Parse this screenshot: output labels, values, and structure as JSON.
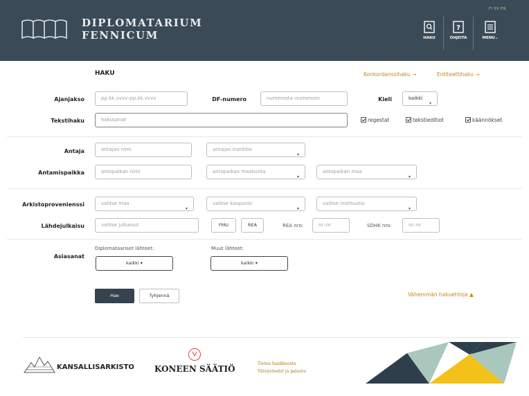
{
  "header": {
    "brand_line1": "DIPLOMATARIUM",
    "brand_line2": "FENNICUM",
    "languages": "FI SV EN",
    "buttons": {
      "search": "HAKU",
      "help": "OHJEITA",
      "menu": "MENU"
    }
  },
  "form": {
    "title": "HAKU",
    "links": {
      "concordance": "Konkordanssihaku →",
      "entity": "Entiteettihaku →"
    },
    "period": {
      "label": "Ajanjakso",
      "placeholder": "pp.kk.vvvv–pp.kk.vvvv"
    },
    "df_number": {
      "label": "DF-numero",
      "placeholder": "numerosta–numeroon"
    },
    "language": {
      "label": "Kieli",
      "value": "kaikki"
    },
    "text_search": {
      "label": "Tekstihaku",
      "placeholder": "hakusanat"
    },
    "checkboxes": [
      "regestat",
      "tekstieditiot",
      "käännökset"
    ],
    "issuer": {
      "label": "Antaja",
      "name_placeholder": "antajan nimi",
      "role_placeholder": "antajan instititio"
    },
    "place": {
      "label": "Antamispaikka",
      "name_placeholder": "antopaikan nimi",
      "region_placeholder": "antopaikan maakunta",
      "country_placeholder": "antopaikan maa"
    },
    "provenance": {
      "label": "Arkistoprovenienssi",
      "country_placeholder": "valitse maa",
      "city_placeholder": "valitse kaupunki",
      "institution_placeholder": "valitse instituutio"
    },
    "source": {
      "label": "Lähdejulkaisu",
      "placeholder": "valitse julkaisut",
      "fmu": "FMU",
      "rea": "REA",
      "rea_label": "REA nro:",
      "rea_placeholder": "nr–nr",
      "sdhk_label": "SDHK nro:",
      "sdhk_placeholder": "nr–nr"
    },
    "documents": {
      "label": "Asiasanat",
      "diplomatic_label": "Diplomataariset lähteet:",
      "diplomatic_value": "kaikki",
      "other_label": "Muut lähteet:",
      "other_value": "kaikki"
    },
    "search_button": "Hae",
    "clear_button": "Tyhjennä",
    "fewer_options": "Vähemmän hakuehtoja ▲"
  },
  "footer": {
    "partner1": "KANSALLISARKISTO",
    "partner2": "KONEEN SÄÄTIÖ",
    "link1": "Tietoa hankkeesta",
    "link2": "Yhteystiedot ja palaute"
  },
  "colors": {
    "header_bg": "#3a4a57",
    "accent": "#c48a18",
    "yellow": "#f2c21a",
    "teal": "#a9c7bd",
    "dark": "#2f3e4b"
  }
}
